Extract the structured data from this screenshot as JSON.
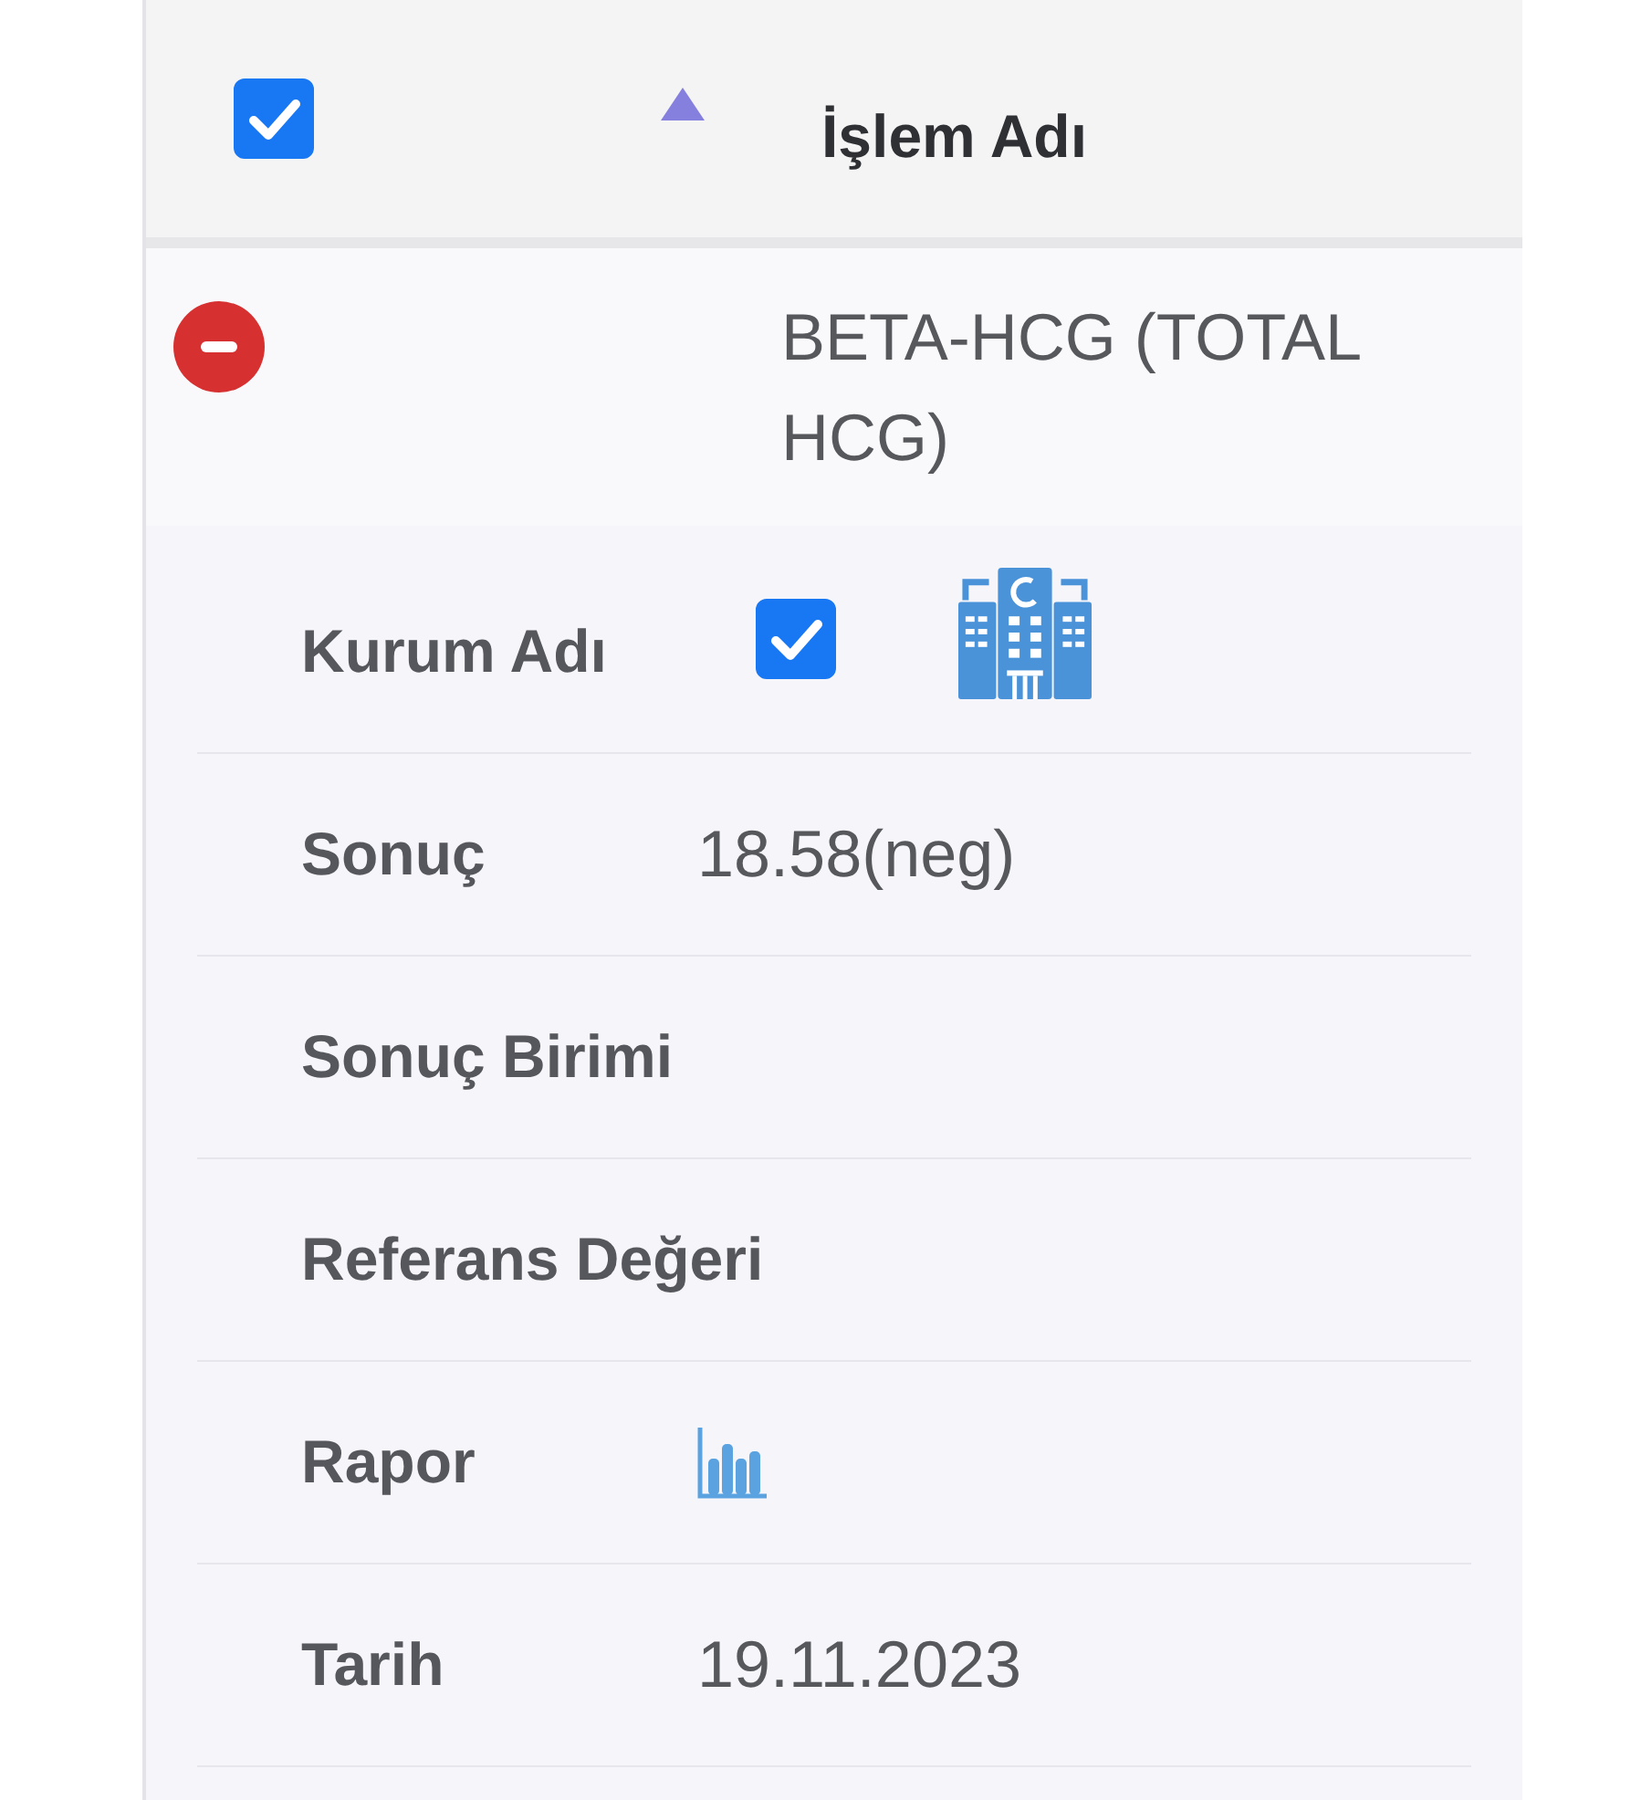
{
  "table": {
    "header": {
      "checked": true,
      "sort_ascending": true,
      "column": "İşlem Adı"
    },
    "rows": [
      {
        "expanded": true,
        "name": "BETA-HCG (TOTAL HCG)",
        "details": [
          {
            "kind": "institution",
            "label": "Kurum Adı",
            "checked": true
          },
          {
            "kind": "text",
            "label": "Sonuç",
            "value": "18.58(neg)"
          },
          {
            "kind": "text",
            "label": "Sonuç Birimi"
          },
          {
            "kind": "text",
            "label": "Referans Değeri"
          },
          {
            "kind": "report",
            "label": "Rapor"
          },
          {
            "kind": "text",
            "label": "Tarih",
            "value": "19.11.2023"
          }
        ]
      }
    ]
  }
}
